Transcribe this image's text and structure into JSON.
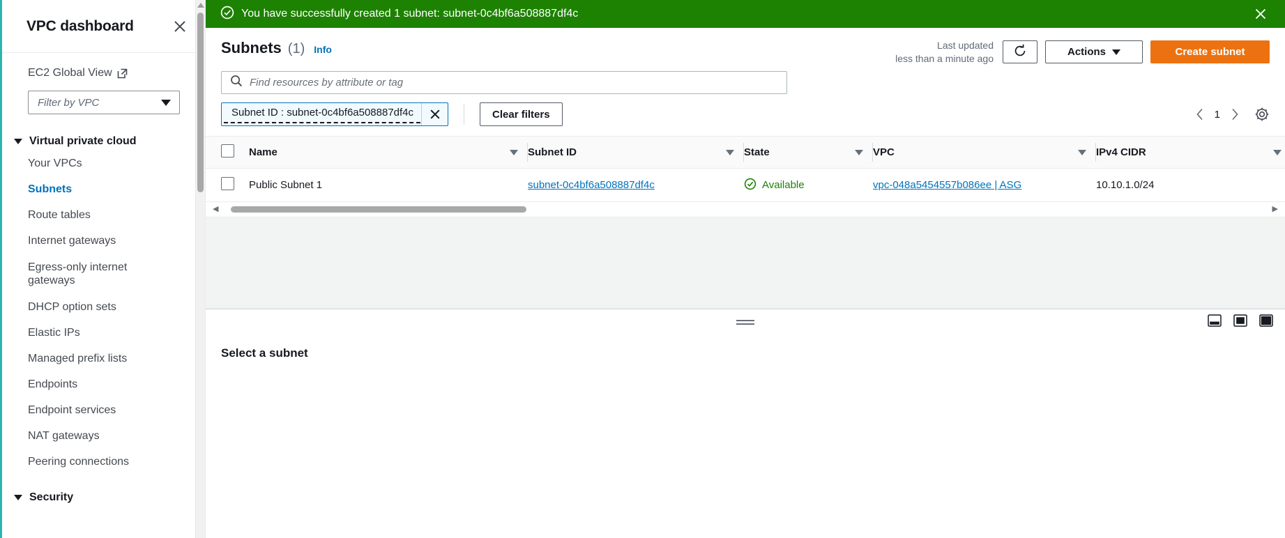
{
  "sidebar": {
    "title": "VPC dashboard",
    "close_icon": "close-icon",
    "ec2_global_view": "EC2 Global View",
    "ec2_global_view_icon": "external-link-icon",
    "vpc_filter_placeholder": "Filter by VPC",
    "groups": [
      {
        "label": "Virtual private cloud",
        "items": [
          {
            "label": "Your VPCs",
            "active": false
          },
          {
            "label": "Subnets",
            "active": true
          },
          {
            "label": "Route tables",
            "active": false
          },
          {
            "label": "Internet gateways",
            "active": false
          },
          {
            "label": "Egress-only internet gateways",
            "active": false
          },
          {
            "label": "DHCP option sets",
            "active": false
          },
          {
            "label": "Elastic IPs",
            "active": false
          },
          {
            "label": "Managed prefix lists",
            "active": false
          },
          {
            "label": "Endpoints",
            "active": false
          },
          {
            "label": "Endpoint services",
            "active": false
          },
          {
            "label": "NAT gateways",
            "active": false
          },
          {
            "label": "Peering connections",
            "active": false
          }
        ]
      },
      {
        "label": "Security",
        "items": []
      }
    ]
  },
  "flash": {
    "icon": "status-success-icon",
    "message": "You have successfully created 1 subnet: subnet-0c4bf6a508887df4c",
    "close_icon": "close-icon",
    "background": "#1d8102"
  },
  "panel": {
    "title": "Subnets",
    "count": "(1)",
    "info_link": "Info",
    "last_updated_label": "Last updated",
    "last_updated_value": "less than a minute ago",
    "refresh_icon": "refresh-icon",
    "actions_label": "Actions",
    "create_label": "Create subnet",
    "create_color": "#ec7211"
  },
  "search": {
    "icon": "search-icon",
    "placeholder": "Find resources by attribute or tag",
    "value": ""
  },
  "filters": {
    "chip_label": "Subnet ID : subnet-0c4bf6a508887df4c",
    "chip_remove_icon": "close-icon",
    "clear_label": "Clear filters",
    "page_prev_icon": "chevron-left-icon",
    "page_number": "1",
    "page_next_icon": "chevron-right-icon",
    "preferences_icon": "gear-icon"
  },
  "table": {
    "columns": [
      {
        "label": "Name",
        "sortable": true
      },
      {
        "label": "Subnet ID",
        "sortable": true
      },
      {
        "label": "State",
        "sortable": true
      },
      {
        "label": "VPC",
        "sortable": true
      },
      {
        "label": "IPv4 CIDR",
        "sortable": true
      }
    ],
    "rows": [
      {
        "name": "Public Subnet 1",
        "subnet_id": "subnet-0c4bf6a508887df4c",
        "state": "Available",
        "state_icon": "status-success-icon",
        "vpc": "vpc-048a5454557b086ee | ASG",
        "ipv4_cidr": "10.10.1.0/24"
      }
    ]
  },
  "split_panel": {
    "title": "Select a subnet",
    "grip_icon": "drag-handle-icon",
    "position_icons": [
      "split-panel-bottom-icon",
      "split-panel-side-icon",
      "split-panel-full-icon"
    ]
  }
}
